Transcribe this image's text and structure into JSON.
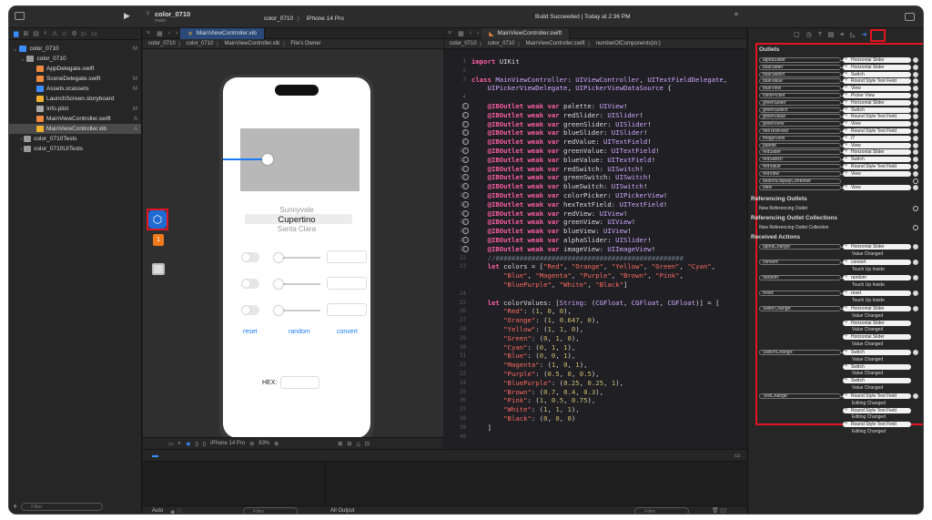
{
  "titlebar": {
    "project": "color_0710",
    "branch": "main",
    "scheme_target": "color_0710",
    "device": "iPhone 14 Pro",
    "status": "Build Succeeded | Today at 2:36 PM"
  },
  "navigator": {
    "root": "color_0710",
    "root_badge": "M",
    "group": "color_0710",
    "files": [
      {
        "name": "AppDelegate.swift",
        "badge": "",
        "color": "#f0883e"
      },
      {
        "name": "SceneDelegate.swift",
        "badge": "M",
        "color": "#f0883e"
      },
      {
        "name": "Assets.xcassets",
        "badge": "M",
        "color": "#3c8dff"
      },
      {
        "name": "LaunchScreen.storyboard",
        "badge": "",
        "color": "#f0b030"
      },
      {
        "name": "Info.plist",
        "badge": "M",
        "color": "#aaaaaa"
      },
      {
        "name": "MainViewController.swift",
        "badge": "A",
        "color": "#f0883e"
      },
      {
        "name": "MainViewController.xib",
        "badge": "A",
        "color": "#f0b030"
      }
    ],
    "test_groups": [
      "color_0710Tests",
      "color_0710UITests"
    ],
    "filter_placeholder": "Filter"
  },
  "left_editor": {
    "tab": "MainViewController.xib",
    "breadcrumb": [
      "color_0710",
      "color_0710",
      "MainViewController.xib",
      "File's Owner"
    ],
    "bottom_device": "iPhone 14 Pro",
    "zoom": "83%",
    "badge_count": "1",
    "canvas": {
      "picker_rows": [
        "Sunnyvale",
        "Cupertino",
        "Santa Clara"
      ],
      "buttons": [
        "reset",
        "random",
        "convert"
      ],
      "hex_label": "HEX:"
    }
  },
  "right_editor": {
    "tab": "MainViewController.swift",
    "breadcrumb": [
      "color_0710",
      "color_0710",
      "MainViewController.swift",
      "numberOfComponents(in:)"
    ]
  },
  "inspector": {
    "outlets_title": "Outlets",
    "outlets": [
      {
        "name": "alphaSlider",
        "target": "Horizontal Slider"
      },
      {
        "name": "blueSlider",
        "target": "Horizontal Slider"
      },
      {
        "name": "blueSwitch",
        "target": "Switch"
      },
      {
        "name": "blueValue",
        "target": "Round Style Text Field"
      },
      {
        "name": "blueView",
        "target": "View"
      },
      {
        "name": "colorPicker",
        "target": "Picker View"
      },
      {
        "name": "greenSlider",
        "target": "Horizontal Slider"
      },
      {
        "name": "greenSwitch",
        "target": "Switch"
      },
      {
        "name": "greenValue",
        "target": "Round Style Text Field"
      },
      {
        "name": "greenView",
        "target": "View"
      },
      {
        "name": "hexTextField",
        "target": "Round Style Text Field"
      },
      {
        "name": "imageView",
        "target": "i?"
      },
      {
        "name": "palette",
        "target": "View"
      },
      {
        "name": "redSlider",
        "target": "Horizontal Slider"
      },
      {
        "name": "redSwitch",
        "target": "Switch"
      },
      {
        "name": "redValue",
        "target": "Round Style Text Field"
      },
      {
        "name": "redView",
        "target": "View"
      },
      {
        "name": "searchDisplayController",
        "target": ""
      },
      {
        "name": "view",
        "target": "View"
      }
    ],
    "ref_outlets_title": "Referencing Outlets",
    "new_ref_outlet": "New Referencing Outlet",
    "ref_collections_title": "Referencing Outlet Collections",
    "new_ref_collection": "New Referencing Outlet Collection",
    "actions_title": "Received Actions",
    "actions": [
      {
        "name": "alphaChange:",
        "targets": [
          {
            "t": "Horizontal Slider",
            "e": "Value Changed"
          }
        ]
      },
      {
        "name": "convert:",
        "targets": [
          {
            "t": "convert",
            "e": "Touch Up Inside"
          }
        ]
      },
      {
        "name": "random:",
        "targets": [
          {
            "t": "random",
            "e": "Touch Up Inside"
          }
        ]
      },
      {
        "name": "reset:",
        "targets": [
          {
            "t": "reset",
            "e": "Touch Up Inside"
          }
        ]
      },
      {
        "name": "SliderChange:",
        "targets": [
          {
            "t": "Horizontal Slider",
            "e": "Value Changed"
          },
          {
            "t": "Horizontal Slider",
            "e": "Value Changed"
          },
          {
            "t": "Horizontal Slider",
            "e": "Value Changed"
          }
        ]
      },
      {
        "name": "SwitchChange:",
        "targets": [
          {
            "t": "Switch",
            "e": "Value Changed"
          },
          {
            "t": "Switch",
            "e": "Value Changed"
          },
          {
            "t": "Switch",
            "e": "Value Changed"
          }
        ]
      },
      {
        "name": "TextChange:",
        "targets": [
          {
            "t": "Round Style Text Field",
            "e": "Editing Changed"
          },
          {
            "t": "Round Style Text Field",
            "e": "Editing Changed"
          },
          {
            "t": "Round Style Text Field",
            "e": "Editing Changed"
          }
        ]
      }
    ]
  },
  "debug": {
    "auto": "Auto",
    "filter": "Filter",
    "output": "All Output"
  },
  "code_lines": [
    {
      "n": "1",
      "html": "<span class='kw'>import</span> UIKit"
    },
    {
      "n": "2",
      "html": ""
    },
    {
      "n": "3",
      "html": "<span class='kw'>class</span> <span class='ty'>MainViewController</span>: <span class='ty'>UIViewController</span>, <span class='ty'>UITextFieldDelegate</span>,"
    },
    {
      "n": "",
      "html": "    <span class='ty'>UIPickerViewDelegate</span>, <span class='ty'>UIPickerViewDataSource</span> {"
    },
    {
      "n": "4",
      "html": ""
    },
    {
      "n": "5",
      "html": "    <span class='kw'>@IBOutlet weak var</span> palette: <span class='ib'>UIView</span>!",
      "g": 1
    },
    {
      "n": "6",
      "html": "    <span class='kw'>@IBOutlet weak var</span> redSlider: <span class='ib'>UISlider</span>!",
      "g": 1
    },
    {
      "n": "7",
      "html": "    <span class='kw'>@IBOutlet weak var</span> greenSlider: <span class='ib'>UISlider</span>!",
      "g": 1
    },
    {
      "n": "8",
      "html": "    <span class='kw'>@IBOutlet weak var</span> blueSlider: <span class='ib'>UISlider</span>!",
      "g": 1
    },
    {
      "n": "9",
      "html": "    <span class='kw'>@IBOutlet weak var</span> redValue: <span class='ib'>UITextField</span>!",
      "g": 1
    },
    {
      "n": "10",
      "html": "    <span class='kw'>@IBOutlet weak var</span> greenValue: <span class='ib'>UITextField</span>!",
      "g": 1
    },
    {
      "n": "11",
      "html": "    <span class='kw'>@IBOutlet weak var</span> blueValue: <span class='ib'>UITextField</span>!",
      "g": 1
    },
    {
      "n": "12",
      "html": "    <span class='kw'>@IBOutlet weak var</span> redSwitch: <span class='ib'>UISwitch</span>!",
      "g": 1
    },
    {
      "n": "13",
      "html": "    <span class='kw'>@IBOutlet weak var</span> greenSwitch: <span class='ib'>UISwitch</span>!",
      "g": 1
    },
    {
      "n": "14",
      "html": "    <span class='kw'>@IBOutlet weak var</span> blueSwitch: <span class='ib'>UISwitch</span>!",
      "g": 1
    },
    {
      "n": "15",
      "html": "    <span class='kw'>@IBOutlet weak var</span> colorPicker: <span class='ib'>UIPickerView</span>!",
      "g": 1
    },
    {
      "n": "16",
      "html": "    <span class='kw'>@IBOutlet weak var</span> hexTextField: <span class='ib'>UITextField</span>!",
      "g": 1
    },
    {
      "n": "17",
      "html": "    <span class='kw'>@IBOutlet weak var</span> redView: <span class='ib'>UIView</span>!",
      "g": 1
    },
    {
      "n": "18",
      "html": "    <span class='kw'>@IBOutlet weak var</span> greenView: <span class='ib'>UIView</span>!",
      "g": 1
    },
    {
      "n": "19",
      "html": "    <span class='kw'>@IBOutlet weak var</span> blueView: <span class='ib'>UIView</span>!",
      "g": 1
    },
    {
      "n": "20",
      "html": "    <span class='kw'>@IBOutlet weak var</span> alphaSlider: <span class='ib'>UISlider</span>!",
      "g": 1
    },
    {
      "n": "21",
      "html": "    <span class='kw'>@IBOutlet weak var</span> imageView: <span class='ib'>UIImageView</span>!",
      "g": 1
    },
    {
      "n": "22",
      "html": "    <span class='cm'>//###############################################</span>"
    },
    {
      "n": "23",
      "html": "    <span class='kw'>let</span> colors = [<span class='str'>\"Red\"</span>, <span class='str'>\"Orange\"</span>, <span class='str'>\"Yellow\"</span>, <span class='str'>\"Green\"</span>, <span class='str'>\"Cyan\"</span>,"
    },
    {
      "n": "",
      "html": "        <span class='str'>\"Blue\"</span>, <span class='str'>\"Magenta\"</span>, <span class='str'>\"Purple\"</span>, <span class='str'>\"Brown\"</span>, <span class='str'>\"Pink\"</span>,"
    },
    {
      "n": "",
      "html": "        <span class='str'>\"BluePurple\"</span>, <span class='str'>\"White\"</span>, <span class='str'>\"Black\"</span>]"
    },
    {
      "n": "24",
      "html": ""
    },
    {
      "n": "25",
      "html": "    <span class='kw'>let</span> colorValues: [<span class='ty'>String</span>: (<span class='ty'>CGFloat</span>, <span class='ty'>CGFloat</span>, <span class='ty'>CGFloat</span>)] = ["
    },
    {
      "n": "26",
      "html": "        <span class='str'>\"Red\"</span>: (<span class='num'>1</span>, <span class='num'>0</span>, <span class='num'>0</span>),"
    },
    {
      "n": "27",
      "html": "        <span class='str'>\"Orange\"</span>: (<span class='num'>1</span>, <span class='num'>0.647</span>, <span class='num'>0</span>),"
    },
    {
      "n": "28",
      "html": "        <span class='str'>\"Yellow\"</span>: (<span class='num'>1</span>, <span class='num'>1</span>, <span class='num'>0</span>),"
    },
    {
      "n": "29",
      "html": "        <span class='str'>\"Green\"</span>: (<span class='num'>0</span>, <span class='num'>1</span>, <span class='num'>0</span>),"
    },
    {
      "n": "30",
      "html": "        <span class='str'>\"Cyan\"</span>: (<span class='num'>0</span>, <span class='num'>1</span>, <span class='num'>1</span>),"
    },
    {
      "n": "31",
      "html": "        <span class='str'>\"Blue\"</span>: (<span class='num'>0</span>, <span class='num'>0</span>, <span class='num'>1</span>),"
    },
    {
      "n": "32",
      "html": "        <span class='str'>\"Magenta\"</span>: (<span class='num'>1</span>, <span class='num'>0</span>, <span class='num'>1</span>),"
    },
    {
      "n": "33",
      "html": "        <span class='str'>\"Purple\"</span>: (<span class='num'>0.5</span>, <span class='num'>0</span>, <span class='num'>0.5</span>),"
    },
    {
      "n": "34",
      "html": "        <span class='str'>\"BluePurple\"</span>: (<span class='num'>0.25</span>, <span class='num'>0.25</span>, <span class='num'>1</span>),"
    },
    {
      "n": "35",
      "html": "        <span class='str'>\"Brown\"</span>: (<span class='num'>0.7</span>, <span class='num'>0.4</span>, <span class='num'>0.3</span>),"
    },
    {
      "n": "36",
      "html": "        <span class='str'>\"Pink\"</span>: (<span class='num'>1</span>, <span class='num'>0.5</span>, <span class='num'>0.75</span>),"
    },
    {
      "n": "37",
      "html": "        <span class='str'>\"White\"</span>: (<span class='num'>1</span>, <span class='num'>1</span>, <span class='num'>1</span>),"
    },
    {
      "n": "38",
      "html": "        <span class='str'>\"Black\"</span>: (<span class='num'>0</span>, <span class='num'>0</span>, <span class='num'>0</span>)"
    },
    {
      "n": "39",
      "html": "    ]"
    },
    {
      "n": "40",
      "html": ""
    }
  ]
}
